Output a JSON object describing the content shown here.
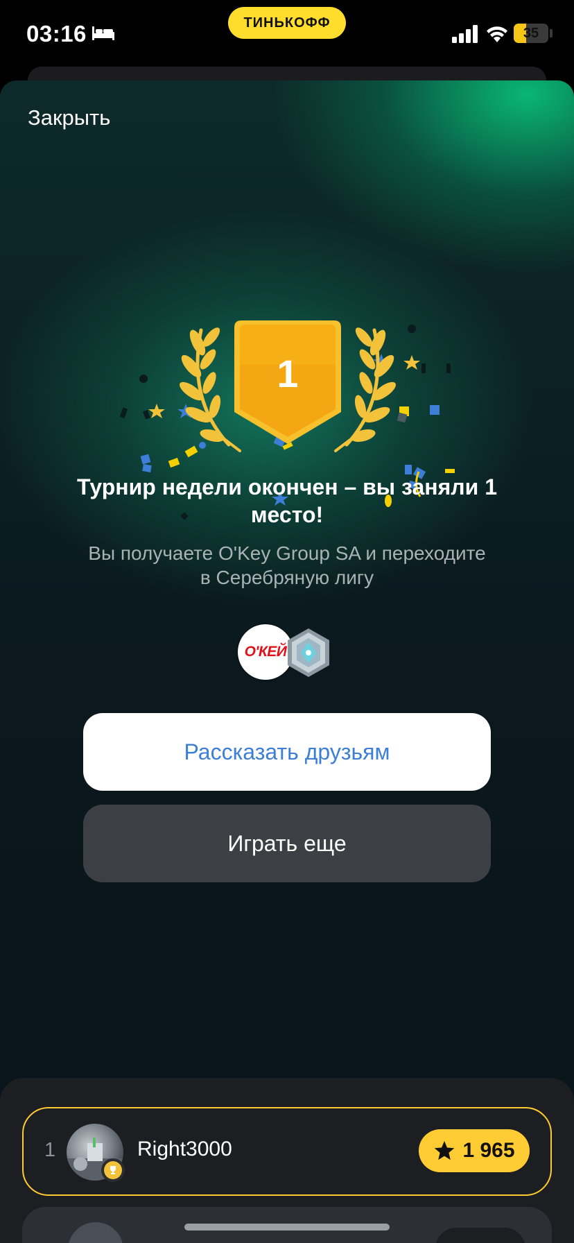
{
  "status_bar": {
    "time": "03:16",
    "bed_icon": "bed-icon",
    "brand": "ТИНЬКОФФ",
    "signal_icon": "cellular-signal-icon",
    "wifi_icon": "wifi-icon",
    "battery_percent": "35",
    "battery_level": 0.35,
    "brand_color": "#ffdd2d"
  },
  "modal": {
    "close_label": "Закрыть",
    "place": "1",
    "headline": "Турнир недели окончен – вы заняли 1 место!",
    "subtext": "Вы получаете O'Key Group SA и переходите в Серебряную лигу",
    "reward_logo_text": "О'КЕЙ",
    "league_icon": "silver-league-icon",
    "share_button": "Рассказать друзьям",
    "play_again_button": "Играть еще"
  },
  "leaderboard": {
    "rows": [
      {
        "rank": "1",
        "name": "Right3000",
        "score": "1 965",
        "score_icon": "star-icon",
        "badge_icon": "trophy-icon"
      }
    ],
    "highlight_color": "#ffcc33"
  }
}
